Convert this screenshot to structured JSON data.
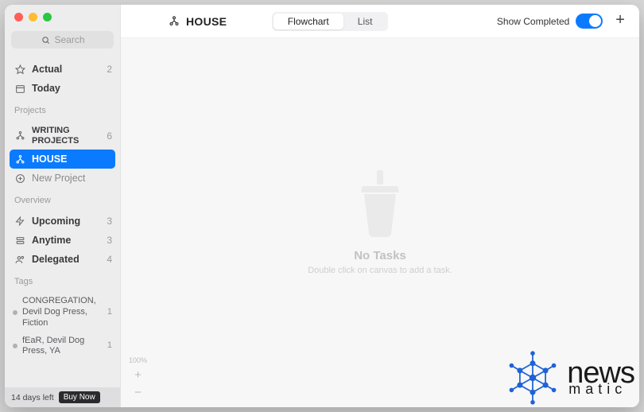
{
  "search": {
    "placeholder": "Search"
  },
  "sidebar": {
    "primary": [
      {
        "label": "Actual",
        "count": "2"
      },
      {
        "label": "Today",
        "count": ""
      }
    ],
    "projects_title": "Projects",
    "projects": [
      {
        "label": "WRITING PROJECTS",
        "count": "6"
      },
      {
        "label": "HOUSE",
        "count": ""
      }
    ],
    "new_project": "New Project",
    "overview_title": "Overview",
    "overview": [
      {
        "label": "Upcoming",
        "count": "3"
      },
      {
        "label": "Anytime",
        "count": "3"
      },
      {
        "label": "Delegated",
        "count": "4"
      }
    ],
    "tags_title": "Tags",
    "tags": [
      {
        "label": "CONGREGATION, Devil Dog Press, Fiction",
        "count": "1"
      },
      {
        "label": "fEaR, Devil Dog Press, YA",
        "count": "1"
      }
    ],
    "trial": {
      "text": "14 days left",
      "button": "Buy Now"
    }
  },
  "header": {
    "title": "HOUSE",
    "seg": {
      "flowchart": "Flowchart",
      "list": "List"
    },
    "show_completed": "Show Completed"
  },
  "empty": {
    "title": "No Tasks",
    "hint": "Double click on canvas to add a task."
  },
  "zoom": {
    "label": "100%"
  },
  "watermark": {
    "brand": "news",
    "sub": "matic"
  }
}
